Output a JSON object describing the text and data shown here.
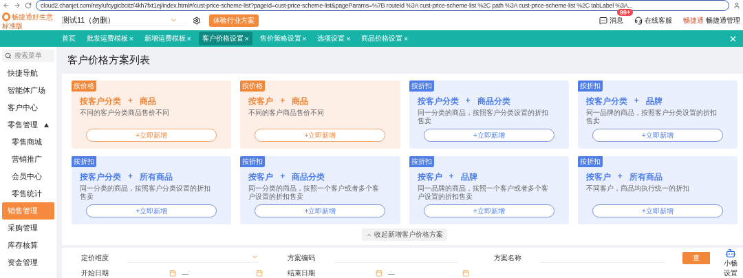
{
  "browser": {
    "url": "cloud2.chanjet.com/nsy/ufcygicbcitz/4kh7fxt1ej/index.html#/cust-price-scheme-list?pageId=cust-price-scheme-list&pageParams=%7B routeId %3A cust-price-scheme-list %2C path %3A cust-price-scheme-list %2C tabLabel %3A..."
  },
  "header": {
    "logo_name": "畅捷通好生意",
    "logo_edition": "标准版",
    "account": "测试11（勿删）",
    "trial_button": "体验行业方案",
    "messages": {
      "label": "消息",
      "badge": "99+"
    },
    "service": "在线客服",
    "user_logo": "畅捷通",
    "user": "畅捷通管理"
  },
  "tabs": [
    {
      "label": "首页",
      "selected": false
    },
    {
      "label": "批发运费模板",
      "selected": false,
      "close": "×"
    },
    {
      "label": "新增运费模板",
      "selected": false,
      "close": "×"
    },
    {
      "label": "客户价格设置",
      "selected": true,
      "close": "×"
    },
    {
      "label": "售价策略设置",
      "selected": false,
      "close": "×"
    },
    {
      "label": "选项设置",
      "selected": false,
      "close": "×"
    },
    {
      "label": "商品价格设置",
      "selected": false,
      "close": "×"
    }
  ],
  "sidebar": {
    "search_placeholder": "搜索菜单",
    "items": [
      {
        "label": "快捷导航",
        "selected": false
      },
      {
        "label": "智能体广场",
        "selected": false
      },
      {
        "label": "客户中心",
        "selected": false
      },
      {
        "label": "零售管理",
        "selected": false,
        "expanded": true,
        "children": [
          {
            "label": "零售商城",
            "selected": false
          },
          {
            "label": "营销推广",
            "selected": false
          },
          {
            "label": "会员中心",
            "selected": false
          },
          {
            "label": "零售统计",
            "selected": false
          }
        ]
      },
      {
        "label": "销售管理",
        "selected": true
      },
      {
        "label": "采购管理",
        "selected": false
      },
      {
        "label": "库存核算",
        "selected": false
      },
      {
        "label": "资金管理",
        "selected": false
      }
    ]
  },
  "page_title": "客户价格方案列表",
  "cards": [
    {
      "kind": "price",
      "tag": "按价格",
      "left": "按客户分类",
      "joiner": "+",
      "right": "商品",
      "description": "不同的客户分类商品售价不同",
      "button": "+立即新增"
    },
    {
      "kind": "price",
      "tag": "按价格",
      "left": "按客户",
      "joiner": "+",
      "right": "商品",
      "description": "不同的客户商品售价不同",
      "button": "+立即新增"
    },
    {
      "kind": "discount",
      "tag": "按折扣",
      "left": "按客户分类",
      "joiner": "+",
      "right": "商品分类",
      "description": "同一分类的商品，按照客户分类设置的折扣售卖",
      "button": "+立即新增"
    },
    {
      "kind": "discount",
      "tag": "按折扣",
      "left": "按客户分类",
      "joiner": "+",
      "right": "品牌",
      "description": "同一品牌的商品，按照客户分类设置的折扣售卖",
      "button": "+立即新增"
    },
    {
      "kind": "discount",
      "tag": "按折扣",
      "left": "按客户分类",
      "joiner": "+",
      "right": "所有商品",
      "description": "同一分类的商品，按照客户分类设置的折扣售卖",
      "button": "+立即新增"
    },
    {
      "kind": "discount",
      "tag": "按折扣",
      "left": "按客户",
      "joiner": "+",
      "right": "商品分类",
      "description": "同一分类的商品，按照一个客户或者多个客户设置的折扣售卖",
      "button": "+立即新增"
    },
    {
      "kind": "discount",
      "tag": "按折扣",
      "left": "按客户",
      "joiner": "+",
      "right": "品牌",
      "description": "同一品牌的商品，按照一个客户或者多个客户设置的折扣售卖",
      "button": "+立即新增"
    },
    {
      "kind": "discount",
      "tag": "按折扣",
      "left": "按客户",
      "joiner": "+",
      "right": "所有商品",
      "description": "不同客户，商品均执行统一的折扣",
      "button": "+立即新增"
    }
  ],
  "collapse_link": "收起新增客户价格方案",
  "filters": [
    {
      "kind": "select",
      "label": "定价维度"
    },
    {
      "kind": "text",
      "label": "方案编码"
    },
    {
      "kind": "text",
      "label": "方案名称"
    },
    {
      "kind": "daterange",
      "label": "开始日期",
      "separator": "—"
    },
    {
      "kind": "daterange",
      "label": "结束日期",
      "separator": "—"
    }
  ],
  "search_button": "查",
  "assistant": {
    "label": "小畅",
    "settings": "设置"
  }
}
